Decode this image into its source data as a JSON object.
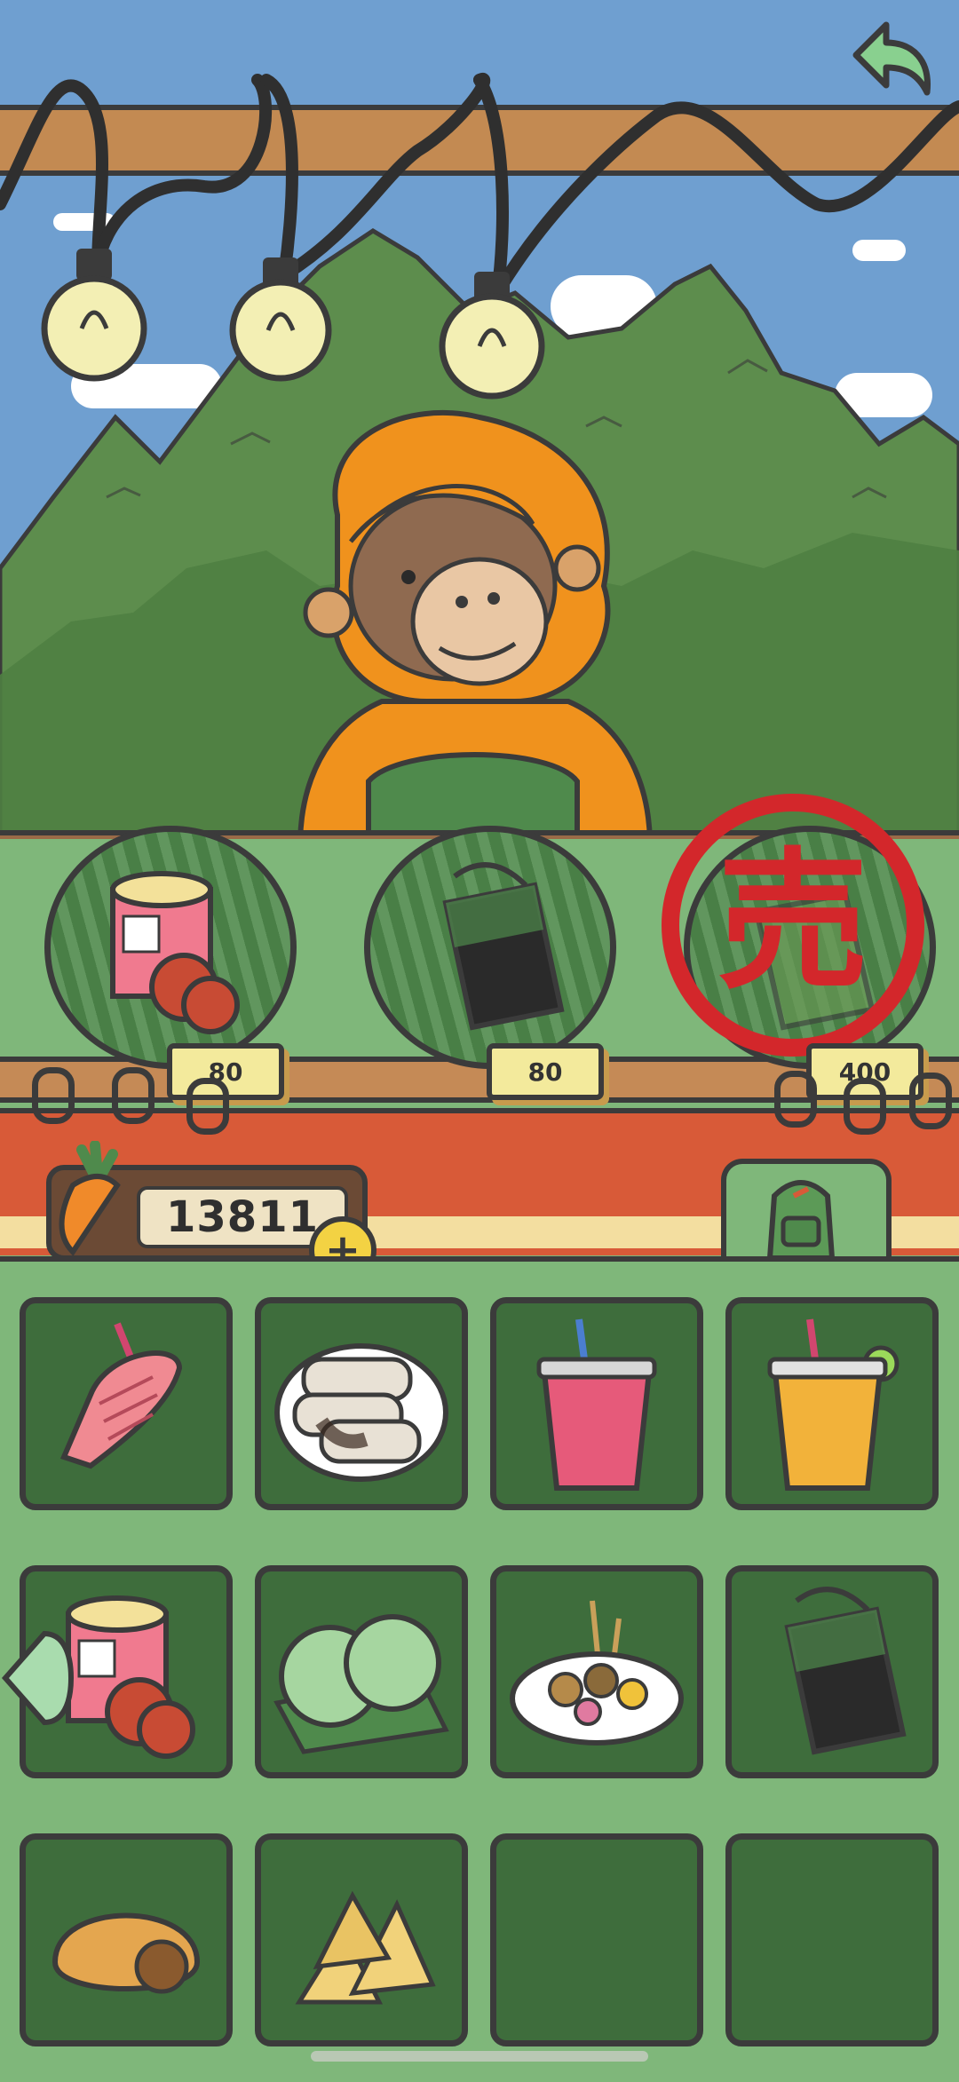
{
  "shop": {
    "counter_items": [
      {
        "name": "canned-mooncake-icon",
        "price": "80"
      },
      {
        "name": "tea-bag-icon",
        "price": "80"
      },
      {
        "name": "sold-out-item-icon",
        "price": "400",
        "stamp_text": "売"
      }
    ]
  },
  "currency": {
    "amount": "13811",
    "plus": "+"
  },
  "inventory": {
    "items": [
      {
        "icon": "taiyaki-ice-cream-icon"
      },
      {
        "icon": "dumplings-plate-icon"
      },
      {
        "icon": "pink-drink-icon"
      },
      {
        "icon": "lemon-iced-tea-icon"
      },
      {
        "icon": "canned-mooncake-icon"
      },
      {
        "icon": "coconut-rice-balls-icon"
      },
      {
        "icon": "skewers-plate-icon"
      },
      {
        "icon": "tea-bag-icon"
      },
      {
        "icon": "empanada-icon"
      },
      {
        "icon": "samosas-icon"
      },
      {
        "icon": "empty-slot"
      },
      {
        "icon": "empty-slot"
      }
    ]
  },
  "colors": {
    "sky": "#6f9fd0",
    "panel_green": "#7fb77a",
    "cell_green": "#3e6d3c",
    "outline": "#3b3b3b",
    "stamp_red": "#d3272b",
    "awning_red": "#d85a38"
  }
}
